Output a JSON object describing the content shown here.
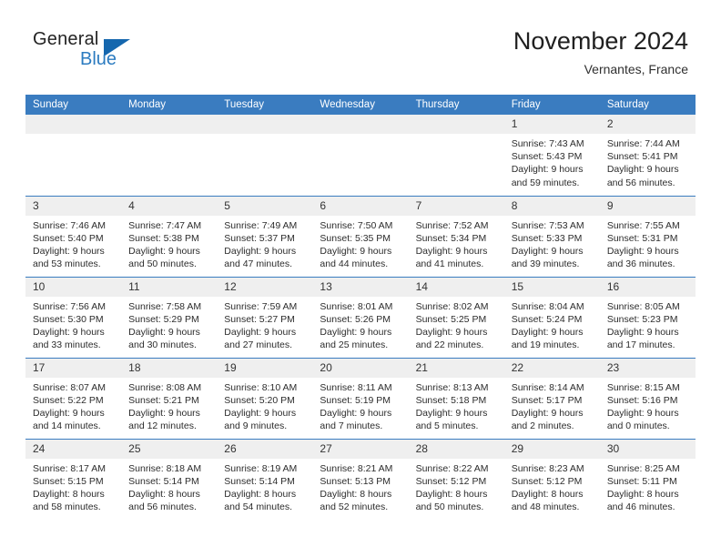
{
  "brand": {
    "name_part1": "General",
    "name_part2": "Blue",
    "triangle_color": "#1567ae",
    "blue_text_color": "#2b7bc0"
  },
  "header": {
    "title": "November 2024",
    "subtitle": "Vernantes, France",
    "accent_color": "#3a7cc0",
    "daynum_band_color": "#efefef"
  },
  "weekday_headers": [
    "Sunday",
    "Monday",
    "Tuesday",
    "Wednesday",
    "Thursday",
    "Friday",
    "Saturday"
  ],
  "labels": {
    "sunrise_prefix": "Sunrise:",
    "sunset_prefix": "Sunset:",
    "daylight_prefix": "Daylight:"
  },
  "weeks": [
    [
      {
        "day": "",
        "empty": true
      },
      {
        "day": "",
        "empty": true
      },
      {
        "day": "",
        "empty": true
      },
      {
        "day": "",
        "empty": true
      },
      {
        "day": "",
        "empty": true
      },
      {
        "day": "1",
        "sunrise": "Sunrise: 7:43 AM",
        "sunset": "Sunset: 5:43 PM",
        "daylight": "Daylight: 9 hours and 59 minutes."
      },
      {
        "day": "2",
        "sunrise": "Sunrise: 7:44 AM",
        "sunset": "Sunset: 5:41 PM",
        "daylight": "Daylight: 9 hours and 56 minutes."
      }
    ],
    [
      {
        "day": "3",
        "sunrise": "Sunrise: 7:46 AM",
        "sunset": "Sunset: 5:40 PM",
        "daylight": "Daylight: 9 hours and 53 minutes."
      },
      {
        "day": "4",
        "sunrise": "Sunrise: 7:47 AM",
        "sunset": "Sunset: 5:38 PM",
        "daylight": "Daylight: 9 hours and 50 minutes."
      },
      {
        "day": "5",
        "sunrise": "Sunrise: 7:49 AM",
        "sunset": "Sunset: 5:37 PM",
        "daylight": "Daylight: 9 hours and 47 minutes."
      },
      {
        "day": "6",
        "sunrise": "Sunrise: 7:50 AM",
        "sunset": "Sunset: 5:35 PM",
        "daylight": "Daylight: 9 hours and 44 minutes."
      },
      {
        "day": "7",
        "sunrise": "Sunrise: 7:52 AM",
        "sunset": "Sunset: 5:34 PM",
        "daylight": "Daylight: 9 hours and 41 minutes."
      },
      {
        "day": "8",
        "sunrise": "Sunrise: 7:53 AM",
        "sunset": "Sunset: 5:33 PM",
        "daylight": "Daylight: 9 hours and 39 minutes."
      },
      {
        "day": "9",
        "sunrise": "Sunrise: 7:55 AM",
        "sunset": "Sunset: 5:31 PM",
        "daylight": "Daylight: 9 hours and 36 minutes."
      }
    ],
    [
      {
        "day": "10",
        "sunrise": "Sunrise: 7:56 AM",
        "sunset": "Sunset: 5:30 PM",
        "daylight": "Daylight: 9 hours and 33 minutes."
      },
      {
        "day": "11",
        "sunrise": "Sunrise: 7:58 AM",
        "sunset": "Sunset: 5:29 PM",
        "daylight": "Daylight: 9 hours and 30 minutes."
      },
      {
        "day": "12",
        "sunrise": "Sunrise: 7:59 AM",
        "sunset": "Sunset: 5:27 PM",
        "daylight": "Daylight: 9 hours and 27 minutes."
      },
      {
        "day": "13",
        "sunrise": "Sunrise: 8:01 AM",
        "sunset": "Sunset: 5:26 PM",
        "daylight": "Daylight: 9 hours and 25 minutes."
      },
      {
        "day": "14",
        "sunrise": "Sunrise: 8:02 AM",
        "sunset": "Sunset: 5:25 PM",
        "daylight": "Daylight: 9 hours and 22 minutes."
      },
      {
        "day": "15",
        "sunrise": "Sunrise: 8:04 AM",
        "sunset": "Sunset: 5:24 PM",
        "daylight": "Daylight: 9 hours and 19 minutes."
      },
      {
        "day": "16",
        "sunrise": "Sunrise: 8:05 AM",
        "sunset": "Sunset: 5:23 PM",
        "daylight": "Daylight: 9 hours and 17 minutes."
      }
    ],
    [
      {
        "day": "17",
        "sunrise": "Sunrise: 8:07 AM",
        "sunset": "Sunset: 5:22 PM",
        "daylight": "Daylight: 9 hours and 14 minutes."
      },
      {
        "day": "18",
        "sunrise": "Sunrise: 8:08 AM",
        "sunset": "Sunset: 5:21 PM",
        "daylight": "Daylight: 9 hours and 12 minutes."
      },
      {
        "day": "19",
        "sunrise": "Sunrise: 8:10 AM",
        "sunset": "Sunset: 5:20 PM",
        "daylight": "Daylight: 9 hours and 9 minutes."
      },
      {
        "day": "20",
        "sunrise": "Sunrise: 8:11 AM",
        "sunset": "Sunset: 5:19 PM",
        "daylight": "Daylight: 9 hours and 7 minutes."
      },
      {
        "day": "21",
        "sunrise": "Sunrise: 8:13 AM",
        "sunset": "Sunset: 5:18 PM",
        "daylight": "Daylight: 9 hours and 5 minutes."
      },
      {
        "day": "22",
        "sunrise": "Sunrise: 8:14 AM",
        "sunset": "Sunset: 5:17 PM",
        "daylight": "Daylight: 9 hours and 2 minutes."
      },
      {
        "day": "23",
        "sunrise": "Sunrise: 8:15 AM",
        "sunset": "Sunset: 5:16 PM",
        "daylight": "Daylight: 9 hours and 0 minutes."
      }
    ],
    [
      {
        "day": "24",
        "sunrise": "Sunrise: 8:17 AM",
        "sunset": "Sunset: 5:15 PM",
        "daylight": "Daylight: 8 hours and 58 minutes."
      },
      {
        "day": "25",
        "sunrise": "Sunrise: 8:18 AM",
        "sunset": "Sunset: 5:14 PM",
        "daylight": "Daylight: 8 hours and 56 minutes."
      },
      {
        "day": "26",
        "sunrise": "Sunrise: 8:19 AM",
        "sunset": "Sunset: 5:14 PM",
        "daylight": "Daylight: 8 hours and 54 minutes."
      },
      {
        "day": "27",
        "sunrise": "Sunrise: 8:21 AM",
        "sunset": "Sunset: 5:13 PM",
        "daylight": "Daylight: 8 hours and 52 minutes."
      },
      {
        "day": "28",
        "sunrise": "Sunrise: 8:22 AM",
        "sunset": "Sunset: 5:12 PM",
        "daylight": "Daylight: 8 hours and 50 minutes."
      },
      {
        "day": "29",
        "sunrise": "Sunrise: 8:23 AM",
        "sunset": "Sunset: 5:12 PM",
        "daylight": "Daylight: 8 hours and 48 minutes."
      },
      {
        "day": "30",
        "sunrise": "Sunrise: 8:25 AM",
        "sunset": "Sunset: 5:11 PM",
        "daylight": "Daylight: 8 hours and 46 minutes."
      }
    ]
  ]
}
